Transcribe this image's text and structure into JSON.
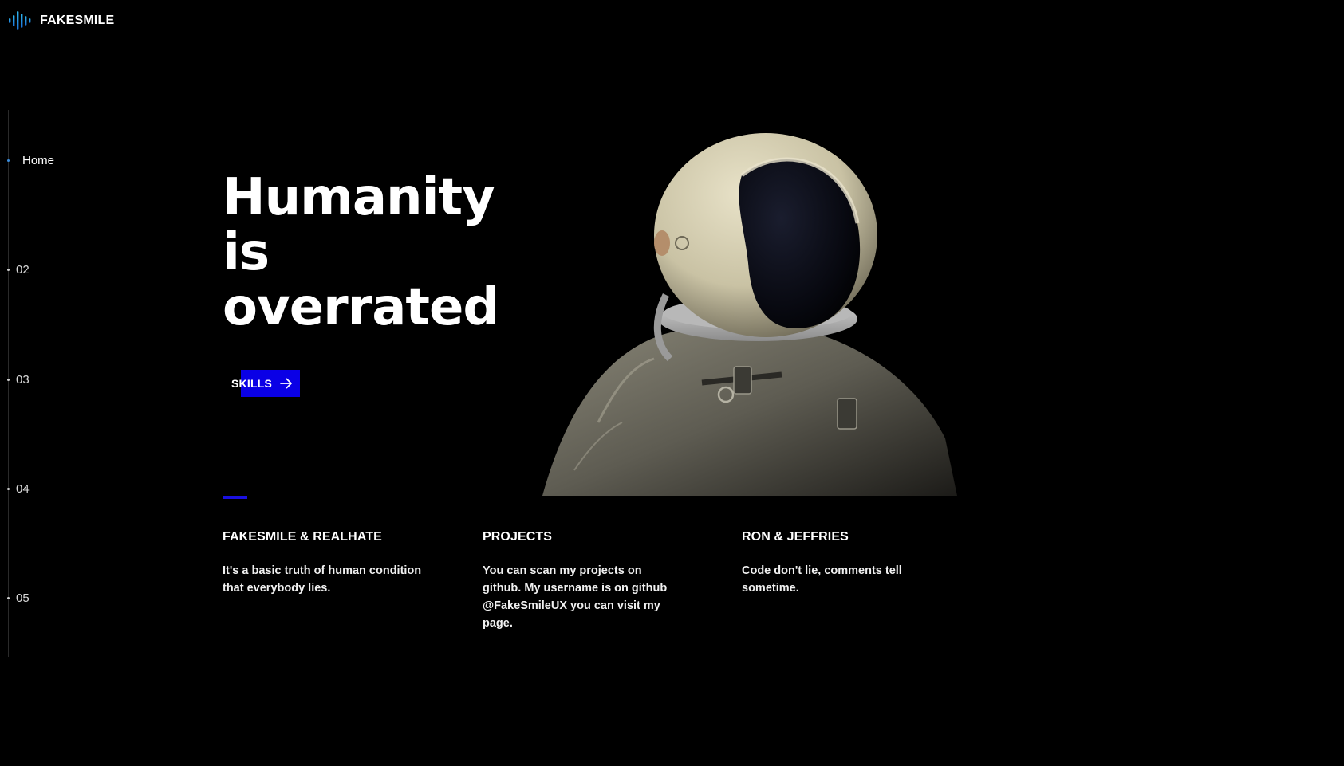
{
  "brand": {
    "name": "FAKESMILE",
    "accent_color": "#0a00e6",
    "logo_icon": "soundwave-icon"
  },
  "side_nav": {
    "items": [
      {
        "label": "Home",
        "active": true
      },
      {
        "label": "02",
        "active": false
      },
      {
        "label": "03",
        "active": false
      },
      {
        "label": "04",
        "active": false
      },
      {
        "label": "05",
        "active": false
      }
    ]
  },
  "hero": {
    "title_lines": [
      "Humanity",
      "is",
      "overrated"
    ],
    "button_label": "SKILLS",
    "button_icon": "arrow-right-icon",
    "image": "astronaut-illustration"
  },
  "columns": [
    {
      "title": "FAKESMILE & REALHATE",
      "text": "It's a basic truth of human condition that everybody lies."
    },
    {
      "title": "PROJECTS",
      "text": "You can scan my projects on github. My username is on github @FakeSmileUX you can visit my page."
    },
    {
      "title": "RON & JEFFRIES",
      "text": "Code don't lie, comments tell sometime."
    }
  ]
}
